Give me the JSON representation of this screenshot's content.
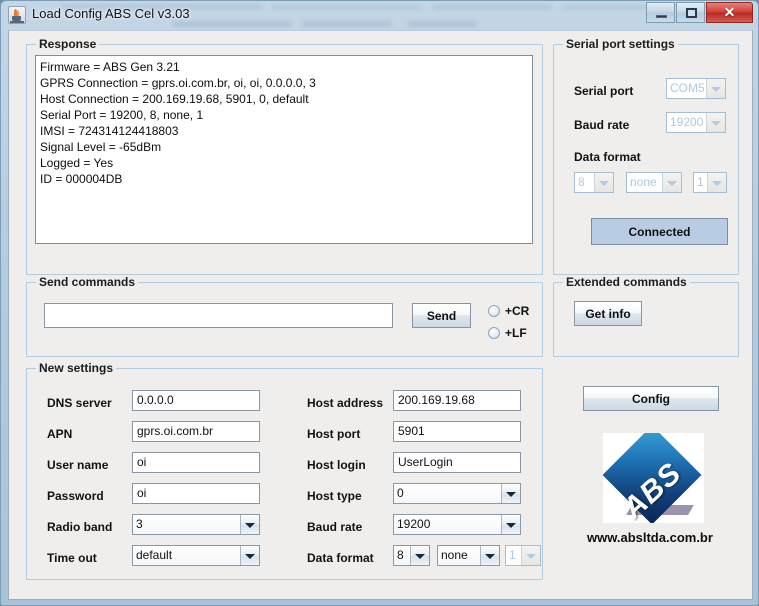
{
  "window": {
    "title": "Load Config ABS Cel v3.03",
    "icon": "java-coffee-cup-icon",
    "minimize_label": "",
    "maximize_label": "",
    "close_label": "✕"
  },
  "response_panel": {
    "title": "Response",
    "lines": [
      "Firmware = ABS Gen 3.21",
      "GPRS Connection = gprs.oi.com.br, oi, oi, 0.0.0.0, 3",
      "Host Connection = 200.169.19.68, 5901, 0, default",
      "Serial Port = 19200, 8, none, 1",
      "IMSI = 724314124418803",
      "Signal Level = -65dBm",
      "Logged = Yes",
      "ID = 000004DB"
    ],
    "text": "Firmware = ABS Gen 3.21\nGPRS Connection = gprs.oi.com.br, oi, oi, 0.0.0.0, 3\nHost Connection = 200.169.19.68, 5901, 0, default\nSerial Port = 19200, 8, none, 1\nIMSI = 724314124418803\nSignal Level = -65dBm\nLogged = Yes\nID = 000004DB"
  },
  "serial_port_settings": {
    "title": "Serial port settings",
    "serial_port_label": "Serial port",
    "serial_port_value": "COM5",
    "baud_rate_label": "Baud rate",
    "baud_rate_value": "19200",
    "data_format_label": "Data format",
    "data_bits_value": "8",
    "parity_value": "none",
    "stop_bits_value": "1",
    "connect_button": "Connected"
  },
  "send_commands": {
    "title": "Send commands",
    "input_value": "",
    "input_placeholder": "",
    "send_button": "Send",
    "cr_label": "+CR",
    "lf_label": "+LF"
  },
  "extended_commands": {
    "title": "Extended commands",
    "get_info_button": "Get info"
  },
  "new_settings": {
    "title": "New settings",
    "left": [
      {
        "label": "DNS server",
        "value": "0.0.0.0",
        "type": "text"
      },
      {
        "label": "APN",
        "value": "gprs.oi.com.br",
        "type": "text"
      },
      {
        "label": "User name",
        "value": "oi",
        "type": "text"
      },
      {
        "label": "Password",
        "value": "oi",
        "type": "text"
      },
      {
        "label": "Radio band",
        "value": "3",
        "type": "combo"
      },
      {
        "label": "Time out",
        "value": "default",
        "type": "combo"
      }
    ],
    "right": [
      {
        "label": "Host address",
        "value": "200.169.19.68",
        "type": "text"
      },
      {
        "label": "Host port",
        "value": "5901",
        "type": "text"
      },
      {
        "label": "Host login",
        "value": "UserLogin",
        "type": "text"
      },
      {
        "label": "Host type",
        "value": "0",
        "type": "combo"
      },
      {
        "label": "Baud rate",
        "value": "19200",
        "type": "combo"
      }
    ],
    "data_format_label": "Data format",
    "data_bits_value": "8",
    "parity_value": "none",
    "stop_bits_value": "1"
  },
  "branding": {
    "config_button": "Config",
    "logo_text": "ABS",
    "website": "www.absltda.com.br"
  },
  "colors": {
    "panel_bg": "#efeeed",
    "group_border": "#b3cde0",
    "accent_blue": "#b8cce4",
    "title_bar": "#b6cddf",
    "close_red": "#cf3f37"
  }
}
